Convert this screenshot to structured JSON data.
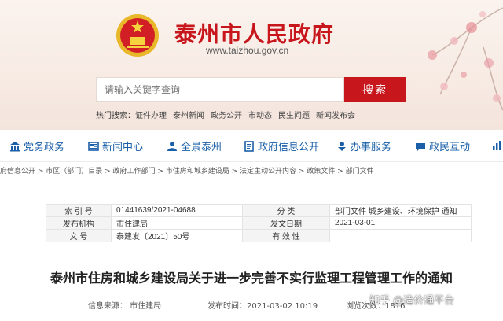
{
  "header": {
    "site_title": "泰州市人民政府",
    "site_url": "www.taizhou.gov.cn",
    "emblem_icon": "national-emblem-icon"
  },
  "search": {
    "placeholder": "请输入关键字查询",
    "button_label": "搜索"
  },
  "hot_search": {
    "label": "热门搜索：",
    "items": [
      "证件办理",
      "泰州新闻",
      "政务公开",
      "市动态",
      "民生问题",
      "新闻发布会"
    ]
  },
  "nav": {
    "items": [
      {
        "label": "党务政务",
        "icon": "building-icon"
      },
      {
        "label": "新闻中心",
        "icon": "newspaper-icon"
      },
      {
        "label": "全景泰州",
        "icon": "person-icon"
      },
      {
        "label": "政府信息公开",
        "icon": "document-icon"
      },
      {
        "label": "办事服务",
        "icon": "service-icon"
      },
      {
        "label": "政民互动",
        "icon": "chat-icon"
      }
    ]
  },
  "breadcrumb": "府信息公开 > 市区（部门）目录 > 政府工作部门 > 市住房和城乡建设局 > 法定主动公开内容 > 政策文件 > 部门文件",
  "meta": {
    "index_label": "索 引 号",
    "index_value": "01441639/2021-04688",
    "category_label": "分 类",
    "category_value": "部门文件 城乡建设、环境保护 通知",
    "org_label": "发布机构",
    "org_value": "市住建局",
    "date_label": "发文日期",
    "date_value": "2021-03-01",
    "docno_label": "文 号",
    "docno_value": "泰建发〔2021〕50号",
    "validity_label": "有 效 性",
    "validity_value": ""
  },
  "document": {
    "title": "泰州市住房和城乡建设局关于进一步完善不实行监理工程管理工作的通知",
    "source": "信息来源： 市住建局",
    "publish_time": "发布时间：2021-03-02 10:19",
    "views": "浏览次数：1816"
  },
  "watermark": "知乎 @造价通平台",
  "colors": {
    "brand_red": "#c8161d",
    "nav_blue": "#1a5fa8"
  }
}
